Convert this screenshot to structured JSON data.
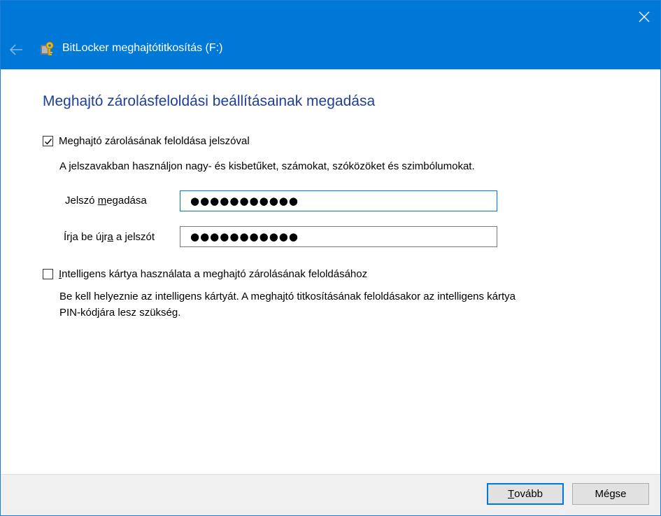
{
  "window": {
    "title": "BitLocker meghajtótitkosítás (F:)"
  },
  "content": {
    "heading": "Meghajtó zárolásfeloldási beállításainak megadása",
    "password_option": {
      "label_pre": "Meghajtó zárolásának feloldása ",
      "label_accel": "j",
      "label_post": "elszóval",
      "checked": true,
      "hint": "A jelszavakban használjon nagy- és kisbetűket, számokat, szóközöket és szimbólumokat."
    },
    "enter_password": {
      "label_pre": "Jelszó ",
      "label_accel": "m",
      "label_post": "egadása",
      "value": "●●●●●●●●●●●"
    },
    "reenter_password": {
      "label_pre": "Írja be újr",
      "label_accel": "a",
      "label_post": " a jelszót",
      "value": "●●●●●●●●●●●"
    },
    "smartcard_option": {
      "label_accel": "I",
      "label_post": "ntelligens kártya használata a meghajtó zárolásának feloldásához",
      "checked": false,
      "hint_line1": "Be kell helyeznie az intelligens kártyát. A meghajtó titkosításának feloldásakor az intelligens kártya",
      "hint_line2": "PIN-kódjára lesz szükség."
    }
  },
  "footer": {
    "next_accel": "T",
    "next_post": "ovább",
    "cancel_label": "Mégse"
  },
  "colors": {
    "titlebar": "#0078d7",
    "heading": "#1e3f9a",
    "footer": "#f0f0f0"
  },
  "icons": {
    "back": "back-arrow-icon",
    "close": "close-icon",
    "app": "bitlocker-keys-icon",
    "check": "checkmark-icon"
  }
}
